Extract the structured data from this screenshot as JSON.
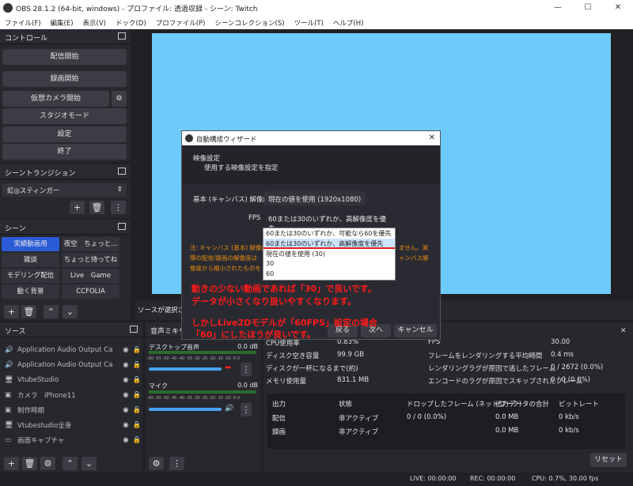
{
  "window": {
    "title": "OBS 28.1.2 (64-bit, windows) - プロファイル: 透過収録 - シーン: Twitch",
    "min": "—",
    "max": "☐",
    "close": "✕"
  },
  "menu": [
    "ファイル(F)",
    "編集(E)",
    "表示(V)",
    "ドック(D)",
    "プロファイル(P)",
    "シーンコレクション(S)",
    "ツール(T)",
    "ヘルプ(H)"
  ],
  "controls": {
    "title": "コントロール",
    "start_stream": "配信開始",
    "start_record": "録画開始",
    "virtual_cam": "仮想カメラ開始",
    "studio": "スタジオモード",
    "settings": "設定",
    "exit": "終了"
  },
  "transitions": {
    "title": "シーントランジション",
    "current": "虹◎スティンガー"
  },
  "scenes": {
    "title": "シーン",
    "items": [
      "実績動画用",
      "夜空　ちょっと...",
      "雑談",
      "ちょっと待ってね",
      "モデリング配信",
      "Live　Game",
      "動く背景",
      "CCFOLIA"
    ]
  },
  "sources": {
    "title": "ソース",
    "items": [
      {
        "icon": "🔊",
        "name": "Application Audio Output Ca"
      },
      {
        "icon": "🔊",
        "name": "Application Audio Output Ca"
      },
      {
        "icon": "🖥",
        "name": "VtubeStudio"
      },
      {
        "icon": "▣",
        "name": "カメラ　iPhone11"
      },
      {
        "icon": "▣",
        "name": "制作時期"
      },
      {
        "icon": "🖥",
        "name": "Vtubestudio全身"
      },
      {
        "icon": "▭",
        "name": "画面キャプチャ"
      }
    ]
  },
  "mixer": {
    "title": "音声ミキサ",
    "tracks": [
      {
        "name": "デスクトップ音声",
        "db": "0.0 dB"
      },
      {
        "name": "マイク",
        "db": "0.0 dB"
      }
    ],
    "scale": "-60 -55 -50 -45 -40 -35 -30 -25 -20 -15 -10 -5 0"
  },
  "no_source": "ソースが選択されて",
  "wizard": {
    "title": "自動構成ウィザード",
    "heading": "映像設定",
    "subheading": "使用する映像設定を指定",
    "base_label": "基本 (キャンバス) 解像度",
    "base_value": "現在の値を使用 (1920x1080)",
    "fps_label": "FPS",
    "fps_value": "60または30のいずれか、高解像度を優先",
    "fps_options": [
      "60または30のいずれか、可能なら60を優先",
      "60または30のいずれか、高解像度を優先",
      "現在の値を使用 (30)",
      "30",
      "60"
    ],
    "note1": "注: キャンバス (基本) 解像度",
    "note1b": "ません。実",
    "note2": "際の配信/録画の解像度は",
    "note2b": "ャンバス解",
    "note3": "像度から縮小されたものを",
    "back": "戻る",
    "next": "次へ",
    "cancel": "キャンセル"
  },
  "annotations": {
    "line1": "動きの少ない動画であれば「30」で良いです。",
    "line2": "データが小さくなり扱いやすくなります。",
    "line3": "しかしLive2Dモデルが「60FPS」設定の場合",
    "line4": "「60」にしたほうが良いです。"
  },
  "stats": {
    "rows_left": [
      {
        "k": "CPU使用率",
        "v": "0.83%"
      },
      {
        "k": "ディスク空き容量",
        "v": "99.9 GB"
      },
      {
        "k": "ディスクが一杯になるまで(約)",
        "v": ""
      },
      {
        "k": "メモリ使用量",
        "v": "831.1 MB"
      }
    ],
    "rows_right": [
      {
        "k": "FPS",
        "v": "30.00"
      },
      {
        "k": "フレームをレンダリングする平均時間",
        "v": "0.4 ms"
      },
      {
        "k": "レンダリングラグが原因で逃したフレーム",
        "v": "0 / 2672 (0.0%)"
      },
      {
        "k": "エンコードのラグが原因でスキップされたフレーム",
        "v": "0 / 0 (0.0%)"
      }
    ],
    "headers": [
      "出力",
      "状態",
      "ドロップしたフレーム (ネットワーク)",
      "出力データの合計",
      "ビットレート"
    ],
    "outputs": [
      [
        "配信",
        "非アクティブ",
        "0 / 0 (0.0%)",
        "0.0 MB",
        "0 kb/s"
      ],
      [
        "録画",
        "非アクティブ",
        "",
        "0.0 MB",
        "0 kb/s"
      ]
    ],
    "reset": "リセット"
  },
  "status": {
    "live": "LIVE: 00:00:00",
    "rec": "REC: 00:00:00",
    "cpu": "CPU: 0.7%, 30.00 fps"
  },
  "colors": {
    "preview": "#6ccbfb",
    "accent": "#ff1a1a",
    "selected": "#2a5bd7"
  }
}
